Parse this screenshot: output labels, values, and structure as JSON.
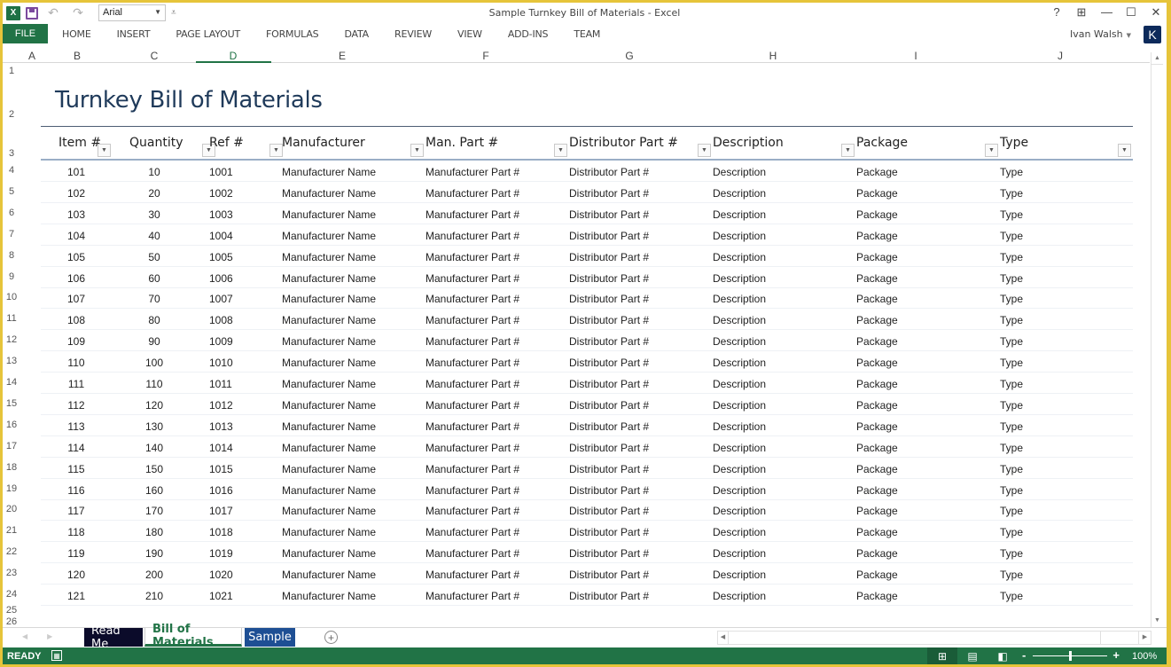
{
  "window": {
    "title": "Sample Turnkey Bill of Materials - Excel",
    "font_name": "Arial",
    "controls": [
      "?",
      "⊞",
      "—",
      "☐",
      "✕"
    ]
  },
  "ribbon": {
    "file_label": "FILE",
    "tabs": [
      "HOME",
      "INSERT",
      "PAGE LAYOUT",
      "FORMULAS",
      "DATA",
      "REVIEW",
      "VIEW",
      "ADD-INS",
      "TEAM"
    ],
    "user_name": "Ivan Walsh",
    "avatar_letter": "K"
  },
  "columns": [
    "A",
    "B",
    "C",
    "D",
    "E",
    "F",
    "G",
    "H",
    "I",
    "J"
  ],
  "active_column": "D",
  "row_numbers": [
    "1",
    "2",
    "3",
    "4",
    "5",
    "6",
    "7",
    "8",
    "9",
    "10",
    "11",
    "12",
    "13",
    "14",
    "15",
    "16",
    "17",
    "18",
    "19",
    "20",
    "21",
    "22",
    "23",
    "24",
    "25",
    "26"
  ],
  "sheet": {
    "title": "Turnkey Bill of Materials",
    "headers": [
      "Item #",
      "Quantity",
      "Ref #",
      "Manufacturer",
      "Man. Part #",
      "Distributor Part #",
      "Description",
      "Package",
      "Type"
    ],
    "rows": [
      [
        "101",
        "10",
        "1001",
        "Manufacturer Name",
        "Manufacturer Part #",
        "Distributor Part #",
        "Description",
        "Package",
        "Type"
      ],
      [
        "102",
        "20",
        "1002",
        "Manufacturer Name",
        "Manufacturer Part #",
        "Distributor Part #",
        "Description",
        "Package",
        "Type"
      ],
      [
        "103",
        "30",
        "1003",
        "Manufacturer Name",
        "Manufacturer Part #",
        "Distributor Part #",
        "Description",
        "Package",
        "Type"
      ],
      [
        "104",
        "40",
        "1004",
        "Manufacturer Name",
        "Manufacturer Part #",
        "Distributor Part #",
        "Description",
        "Package",
        "Type"
      ],
      [
        "105",
        "50",
        "1005",
        "Manufacturer Name",
        "Manufacturer Part #",
        "Distributor Part #",
        "Description",
        "Package",
        "Type"
      ],
      [
        "106",
        "60",
        "1006",
        "Manufacturer Name",
        "Manufacturer Part #",
        "Distributor Part #",
        "Description",
        "Package",
        "Type"
      ],
      [
        "107",
        "70",
        "1007",
        "Manufacturer Name",
        "Manufacturer Part #",
        "Distributor Part #",
        "Description",
        "Package",
        "Type"
      ],
      [
        "108",
        "80",
        "1008",
        "Manufacturer Name",
        "Manufacturer Part #",
        "Distributor Part #",
        "Description",
        "Package",
        "Type"
      ],
      [
        "109",
        "90",
        "1009",
        "Manufacturer Name",
        "Manufacturer Part #",
        "Distributor Part #",
        "Description",
        "Package",
        "Type"
      ],
      [
        "110",
        "100",
        "1010",
        "Manufacturer Name",
        "Manufacturer Part #",
        "Distributor Part #",
        "Description",
        "Package",
        "Type"
      ],
      [
        "111",
        "110",
        "1011",
        "Manufacturer Name",
        "Manufacturer Part #",
        "Distributor Part #",
        "Description",
        "Package",
        "Type"
      ],
      [
        "112",
        "120",
        "1012",
        "Manufacturer Name",
        "Manufacturer Part #",
        "Distributor Part #",
        "Description",
        "Package",
        "Type"
      ],
      [
        "113",
        "130",
        "1013",
        "Manufacturer Name",
        "Manufacturer Part #",
        "Distributor Part #",
        "Description",
        "Package",
        "Type"
      ],
      [
        "114",
        "140",
        "1014",
        "Manufacturer Name",
        "Manufacturer Part #",
        "Distributor Part #",
        "Description",
        "Package",
        "Type"
      ],
      [
        "115",
        "150",
        "1015",
        "Manufacturer Name",
        "Manufacturer Part #",
        "Distributor Part #",
        "Description",
        "Package",
        "Type"
      ],
      [
        "116",
        "160",
        "1016",
        "Manufacturer Name",
        "Manufacturer Part #",
        "Distributor Part #",
        "Description",
        "Package",
        "Type"
      ],
      [
        "117",
        "170",
        "1017",
        "Manufacturer Name",
        "Manufacturer Part #",
        "Distributor Part #",
        "Description",
        "Package",
        "Type"
      ],
      [
        "118",
        "180",
        "1018",
        "Manufacturer Name",
        "Manufacturer Part #",
        "Distributor Part #",
        "Description",
        "Package",
        "Type"
      ],
      [
        "119",
        "190",
        "1019",
        "Manufacturer Name",
        "Manufacturer Part #",
        "Distributor Part #",
        "Description",
        "Package",
        "Type"
      ],
      [
        "120",
        "200",
        "1020",
        "Manufacturer Name",
        "Manufacturer Part #",
        "Distributor Part #",
        "Description",
        "Package",
        "Type"
      ],
      [
        "121",
        "210",
        "1021",
        "Manufacturer Name",
        "Manufacturer Part #",
        "Distributor Part #",
        "Description",
        "Package",
        "Type"
      ]
    ]
  },
  "sheet_tabs": {
    "tabs": [
      "Read Me",
      "Bill of Materials",
      "Sample"
    ],
    "active": "Bill of Materials",
    "add_label": "+"
  },
  "status_bar": {
    "mode": "READY",
    "zoom_percent": 100,
    "zoom_label": "100%"
  },
  "colors": {
    "excel_green": "#217346",
    "title_blue": "#1f3a5a",
    "read_me_tab": "#0b0b2a",
    "sample_tab": "#1e4f94",
    "frame_yellow": "#e6c43a"
  }
}
